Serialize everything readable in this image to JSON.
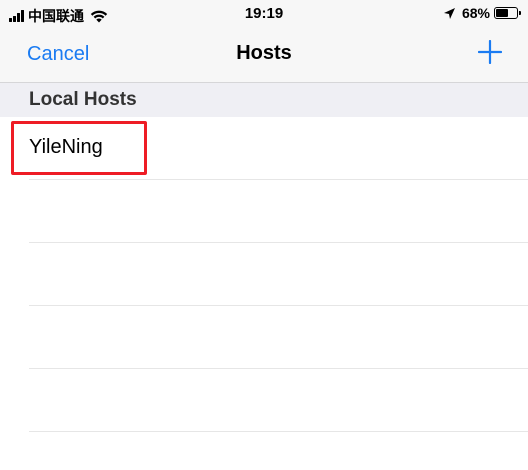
{
  "status_bar": {
    "carrier": "中国联通",
    "time": "19:19",
    "battery_percent": "68%",
    "battery_level": 0.68,
    "icons": [
      "signal-icon",
      "wifi-icon",
      "location-icon",
      "battery-icon"
    ]
  },
  "nav": {
    "cancel_label": "Cancel",
    "title": "Hosts",
    "add_icon": "plus-icon",
    "accent_color": "#1a7bf2"
  },
  "section": {
    "title": "Local Hosts"
  },
  "hosts": [
    {
      "name": "YileNing"
    }
  ],
  "highlight_color": "#ee1c25"
}
